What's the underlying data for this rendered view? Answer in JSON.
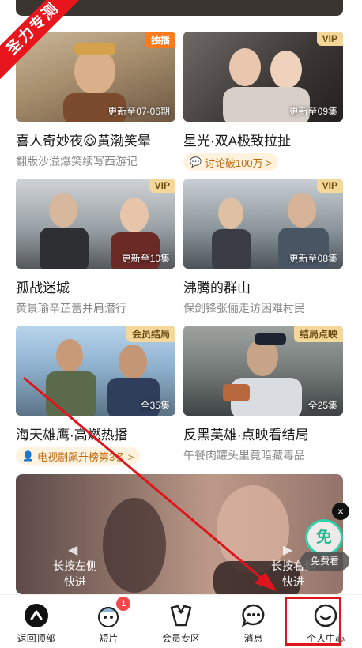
{
  "watermark": "圣力专测",
  "cards": [
    {
      "badge": "独播",
      "badge_style": "orange",
      "episode": "更新至07-06期",
      "title": "喜人奇妙夜😆黄渤笑晕",
      "sub": "翻版沙溢爆笑续写西游记"
    },
    {
      "badge": "VIP",
      "badge_style": "gold",
      "episode": "更新至09集",
      "title": "星光·双A极致拉扯",
      "pill": "讨论破100万 >",
      "pill_icon": "chat-bubble-icon"
    },
    {
      "badge": "VIP",
      "badge_style": "gold",
      "episode": "更新至10集",
      "title": "孤战迷城",
      "sub": "黄景瑜辛芷蕾并肩潜行"
    },
    {
      "badge": "VIP",
      "badge_style": "gold",
      "episode": "更新至08集",
      "title": "沸腾的群山",
      "sub": "保剑锋张俪走访困难村民"
    },
    {
      "badge": "会员结局",
      "badge_style": "gold",
      "episode": "全35集",
      "title": "海天雄鹰·高燃热播",
      "pill": "电视剧飙升榜第3名 >",
      "pill_icon": "rank-person-icon"
    },
    {
      "badge": "结局点映",
      "badge_style": "gold",
      "episode": "全25集",
      "title": "反黑英雄·点映看结局",
      "sub": "午餐肉罐头里竟暗藏毒品"
    }
  ],
  "banner": {
    "left_hint": "长按左侧\n快进",
    "right_hint": "长按右侧\n快进"
  },
  "free": {
    "icon_text": "免",
    "label": "免费看",
    "close": "×"
  },
  "tabs": [
    {
      "name": "back-to-top",
      "label": "返回顶部",
      "icon": "caret-up-icon"
    },
    {
      "name": "shorts",
      "label": "短片",
      "icon": "mascot-icon",
      "badge": "1"
    },
    {
      "name": "vip-zone",
      "label": "会员专区",
      "icon": "tuxedo-icon"
    },
    {
      "name": "messages",
      "label": "消息",
      "icon": "chat-dots-icon"
    },
    {
      "name": "profile",
      "label": "个人中心",
      "icon": "smile-icon"
    }
  ],
  "colors": {
    "highlight": "#e0141c",
    "arrow": "#e0141c",
    "accent_orange": "#ff7a1a",
    "badge_gold": "#f4d89a",
    "free_green": "#2fcfa8"
  }
}
